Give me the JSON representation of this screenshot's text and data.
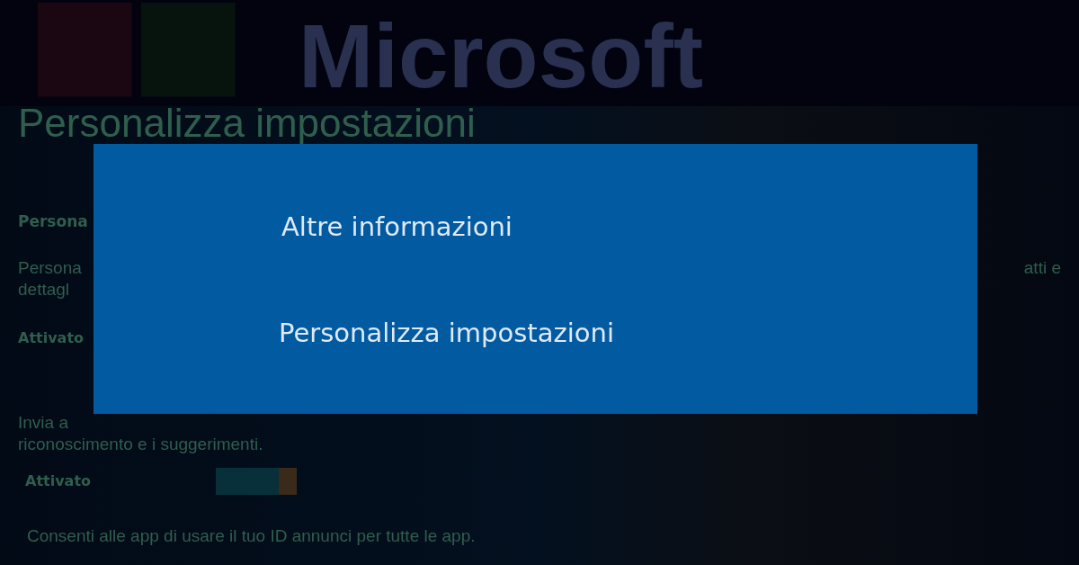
{
  "logo_text": "Microsoft",
  "page": {
    "title": "Personalizza impostazioni"
  },
  "settings": [
    {
      "kind": "heading",
      "text": "Persona"
    },
    {
      "kind": "split",
      "left": "Persona",
      "right": "atti e"
    },
    {
      "kind": "text",
      "text": "dettagl"
    },
    {
      "kind": "label",
      "text": "Attivato"
    },
    {
      "kind": "text",
      "text": "Invia a"
    },
    {
      "kind": "text",
      "text": "riconoscimento e i suggerimenti."
    },
    {
      "kind": "toggle",
      "label": "Attivato",
      "on": true
    },
    {
      "kind": "text",
      "text": "Consenti alle app di usare il tuo ID annunci per tutte le app."
    }
  ],
  "dialog": {
    "options": [
      "Altre informazioni",
      "Personalizza impostazioni"
    ]
  }
}
